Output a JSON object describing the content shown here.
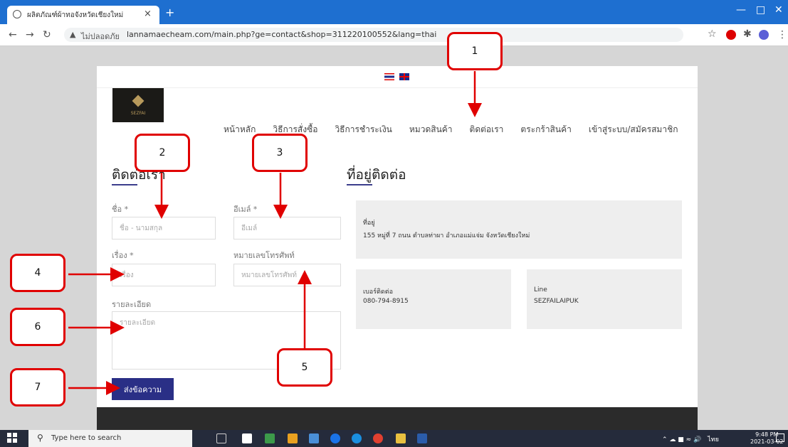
{
  "browser": {
    "tab_title": "ผลิตภัณฑ์ผ้าทอจังหวัดเชียงใหม่",
    "tab_close": "×",
    "new_tab": "+",
    "insecure_label": "ไม่ปลอดภัย",
    "url": "lannamaecheam.com/main.php?ge=contact&shop=311220100552&lang=thai"
  },
  "site": {
    "logo_text": "SEZFAI",
    "menu": [
      "หน้าหลัก",
      "วิธีการสั่งซื้อ",
      "วิธีการชำระเงิน",
      "หมวดสินค้า",
      "ติดต่อเรา",
      "ตระกร้าสินค้า",
      "เข้าสู่ระบบ/สมัครสมาชิก"
    ]
  },
  "contact_form": {
    "heading": "ติดต่อเรา",
    "name_label": "ชื่อ *",
    "name_placeholder": "ชื่อ - นามสกุล",
    "email_label": "อีเมล์ *",
    "email_placeholder": "อีเมล์",
    "subject_label": "เรื่อง *",
    "subject_placeholder": "เรื่อง",
    "phone_label": "หมายเลขโทรศัพท์",
    "phone_placeholder": "หมายเลขโทรศัพท์",
    "detail_label": "รายละเอียด",
    "detail_placeholder": "รายละเอียด",
    "submit_label": "ส่งข้อความ"
  },
  "contact_info": {
    "heading": "ที่อยู่ติดต่อ",
    "address_label": "ที่อยู่",
    "address_value": "155 หมู่ที่ 7 ถนน ตำบลท่าผา อำเภอแม่แจ่ม จังหวัดเชียงใหม่",
    "phone_label": "เบอร์ติดต่อ",
    "phone_value": "080-794-8915",
    "line_label": "Line",
    "line_value": "SEZFAILAIPUK"
  },
  "callouts": [
    "1",
    "2",
    "3",
    "4",
    "5",
    "6",
    "7"
  ],
  "taskbar": {
    "search_text": "Type here to search",
    "time": "9:48 PM",
    "date": "2021-03-02",
    "lang": "ไทย"
  }
}
